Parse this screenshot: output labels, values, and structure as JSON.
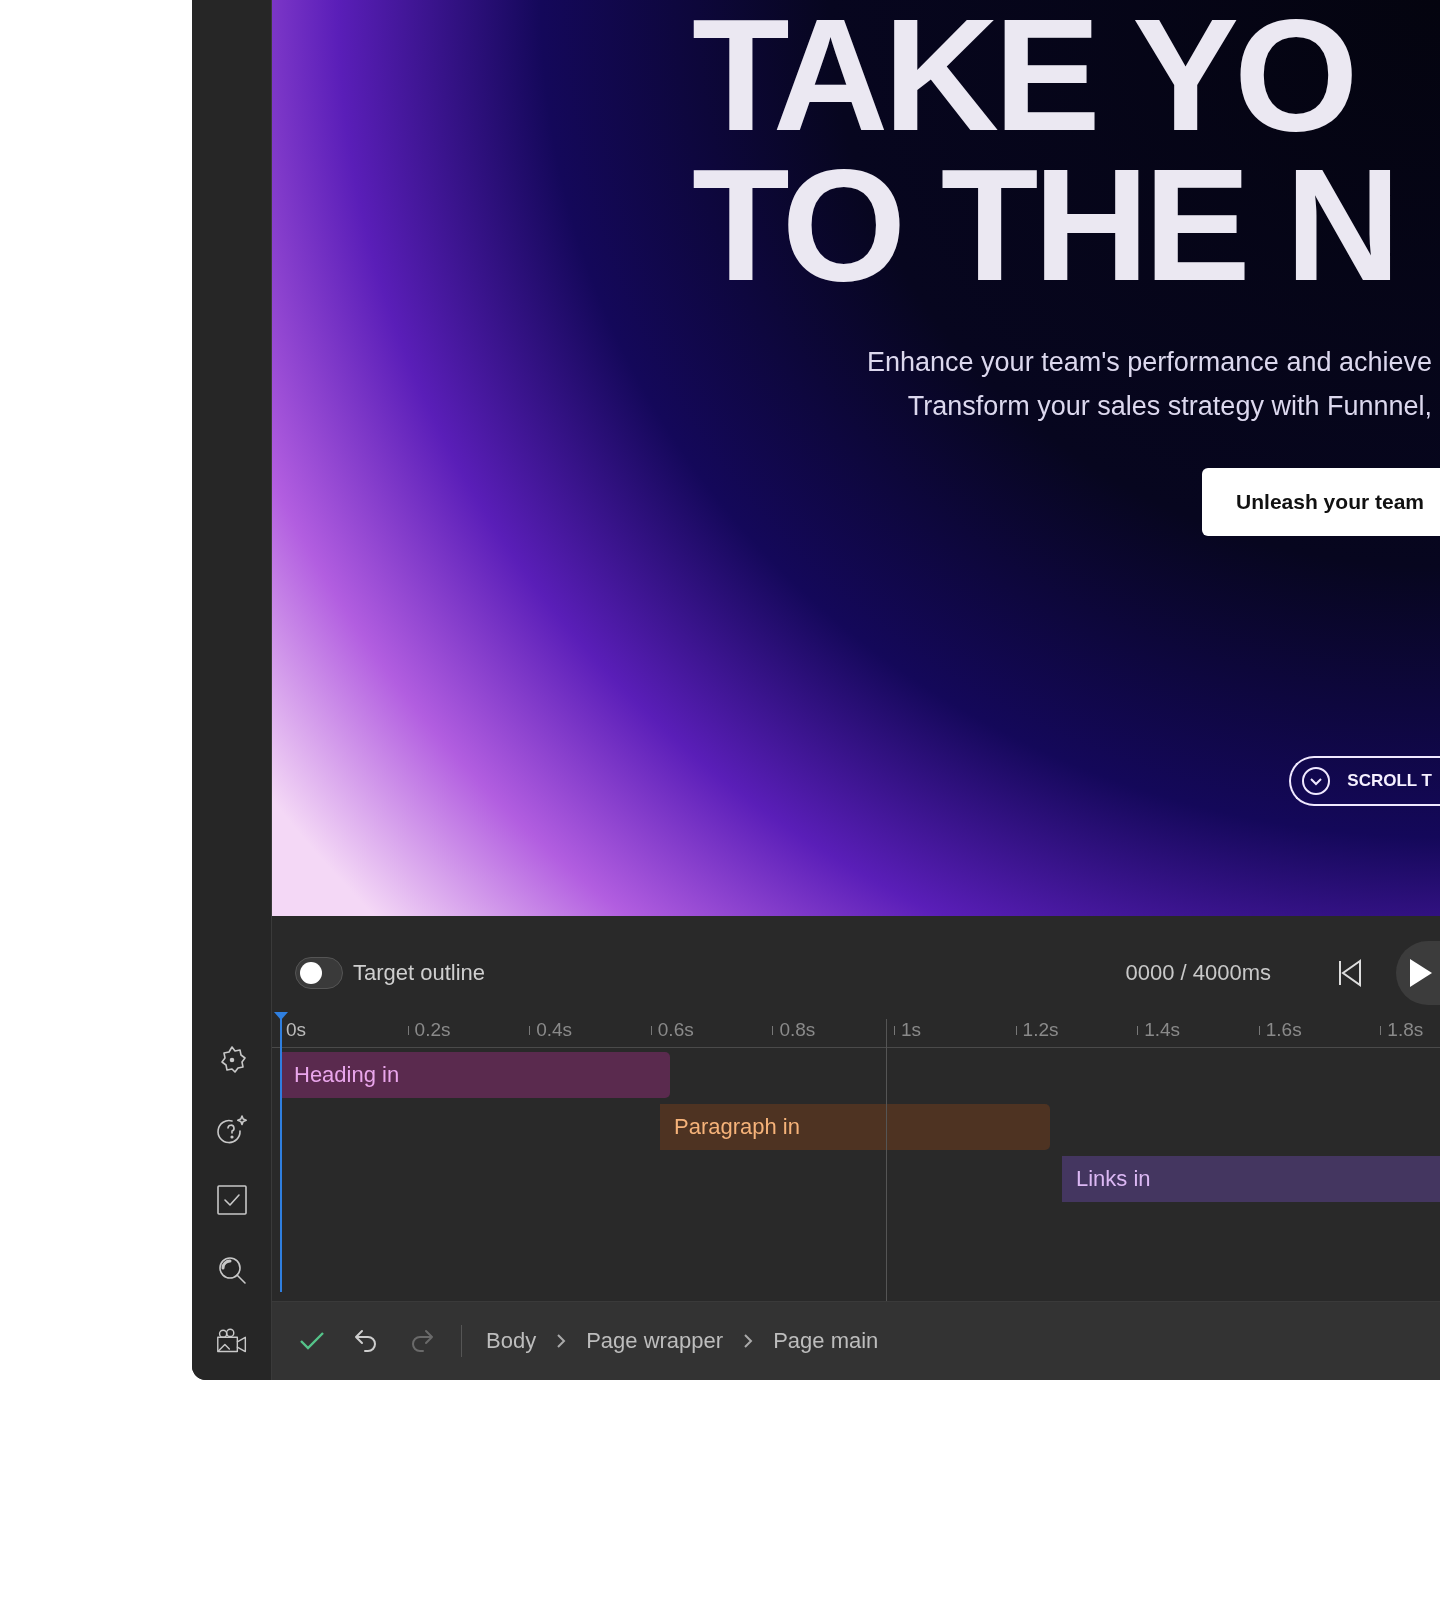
{
  "canvas": {
    "heading_lines": [
      "TAKE YO",
      "TO THE N"
    ],
    "paragraph_lines": [
      "Enhance your team's performance and achieve",
      "Transform your sales strategy with Funnnel,"
    ],
    "cta_button": "Unleash your team",
    "scroll_button": "SCROLL T"
  },
  "timeline": {
    "target_outline": {
      "label": "Target outline",
      "on": false
    },
    "time": "0000 / 4000ms",
    "ticks": [
      "0s",
      "0.2s",
      "0.4s",
      "0.6s",
      "0.8s",
      "1s",
      "1.2s",
      "1.4s",
      "1.6s",
      "1.8s"
    ],
    "tracks": [
      {
        "label": "Heading in",
        "color": "#5a2a4e"
      },
      {
        "label": "Paragraph in",
        "color": "#4e3322"
      },
      {
        "label": "Links in",
        "color": "#443660"
      }
    ]
  },
  "status_bar": {
    "history": [
      {
        "kind": "undo",
        "disabled": false
      },
      {
        "kind": "redo",
        "disabled": true
      }
    ],
    "breadcrumbs": [
      "Body",
      "Page wrapper",
      "Page main"
    ]
  }
}
